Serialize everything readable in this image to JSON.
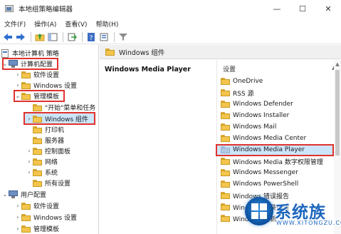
{
  "window": {
    "title": "本地组策略编辑器",
    "controls": {
      "minimize": "—",
      "maximize": "☐",
      "close": "✕"
    }
  },
  "menu": [
    "文件(F)",
    "操作(A)",
    "查看(V)",
    "帮助(H)"
  ],
  "toolbar": {
    "icons": [
      "back-arrow-icon",
      "forward-arrow-icon",
      "up-folder-icon",
      "show-hide-tree-icon",
      "export-list-icon",
      "help-icon",
      "properties-icon",
      "filter-icon"
    ]
  },
  "tree": {
    "items": [
      {
        "label": "本地计算机 策略",
        "icon": "document-icon",
        "twisty": ""
      },
      {
        "label": "计算机配置",
        "icon": "computer-icon",
        "twisty": "⌄"
      },
      {
        "label": "软件设置",
        "icon": "folder-icon",
        "twisty": "›"
      },
      {
        "label": "Windows 设置",
        "icon": "folder-icon",
        "twisty": "›"
      },
      {
        "label": "管理模板",
        "icon": "folder-icon",
        "twisty": "⌄"
      },
      {
        "label": "\"开始\"菜单和任务",
        "icon": "folder-icon",
        "twisty": ""
      },
      {
        "label": "Windows 组件",
        "icon": "folder-icon",
        "twisty": "›"
      },
      {
        "label": "打印机",
        "icon": "folder-icon",
        "twisty": ""
      },
      {
        "label": "服务器",
        "icon": "folder-icon",
        "twisty": ""
      },
      {
        "label": "控制面板",
        "icon": "folder-icon",
        "twisty": "›"
      },
      {
        "label": "网络",
        "icon": "folder-icon",
        "twisty": "›"
      },
      {
        "label": "系统",
        "icon": "folder-icon",
        "twisty": "›"
      },
      {
        "label": "所有设置",
        "icon": "folder-icon",
        "twisty": ""
      },
      {
        "label": "用户配置",
        "icon": "computer-icon",
        "twisty": "⌄"
      },
      {
        "label": "软件设置",
        "icon": "folder-icon",
        "twisty": "›"
      },
      {
        "label": "Windows 设置",
        "icon": "folder-icon",
        "twisty": "›"
      },
      {
        "label": "管理模板",
        "icon": "folder-icon",
        "twisty": "›"
      }
    ],
    "selected": "Windows 组件"
  },
  "right": {
    "header": "Windows 组件",
    "description_title": "Windows Media Player",
    "column_header": "设置",
    "items": [
      "OneDrive",
      "RSS 源",
      "Windows Defender",
      "Windows Installer",
      "Windows Mail",
      "Windows Media Center",
      "Windows Media Player",
      "Windows Media 数字权限管理",
      "Windows Messenger",
      "Windows PowerShell",
      "Windows 错误报告",
      "Windows 登录选项",
      "Windows 更新"
    ],
    "selected": "Windows Media Player"
  },
  "watermark": {
    "text": "系统族",
    "url": "WWW.XITONGZU.COM"
  },
  "colors": {
    "highlight_box": "#e0322e",
    "selection": "#cde5fb",
    "folder": "#f3c54c",
    "watermark": "#1d67bd"
  }
}
